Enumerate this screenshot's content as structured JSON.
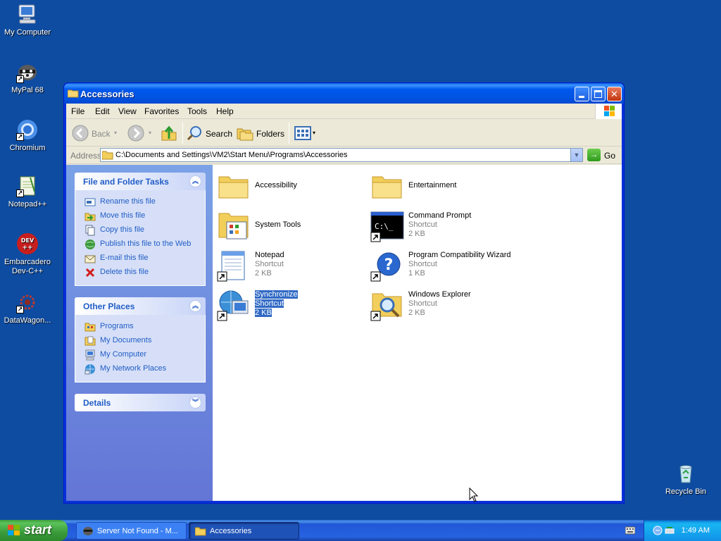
{
  "desktop": {
    "icons": [
      {
        "label": "My Computer",
        "icon": "my-computer-icon"
      },
      {
        "label": "MyPal 68",
        "icon": "mypal-icon"
      },
      {
        "label": "Chromium",
        "icon": "chromium-icon"
      },
      {
        "label": "Notepad++",
        "icon": "notepadpp-icon"
      },
      {
        "label": "Embarcadero Dev-C++",
        "label_line1": "Embarcadero",
        "label_line2": "Dev-C++",
        "icon": "devcpp-icon"
      },
      {
        "label": "DataWagon...",
        "icon": "datawagon-icon"
      },
      {
        "label": "Recycle Bin",
        "icon": "recycle-bin-icon"
      }
    ]
  },
  "window": {
    "title": "Accessories",
    "menu": [
      "File",
      "Edit",
      "View",
      "Favorites",
      "Tools",
      "Help"
    ],
    "toolbar": {
      "back_label": "Back",
      "search_label": "Search",
      "folders_label": "Folders"
    },
    "address": {
      "label": "Address",
      "value": "C:\\Documents and Settings\\VM2\\Start Menu\\Programs\\Accessories",
      "go_label": "Go"
    },
    "taskpane": {
      "file_tasks": {
        "title": "File and Folder Tasks",
        "items": [
          {
            "label": "Rename this file",
            "icon": "rename-icon"
          },
          {
            "label": "Move this file",
            "icon": "move-icon"
          },
          {
            "label": "Copy this file",
            "icon": "copy-icon"
          },
          {
            "label": "Publish this file to the Web",
            "icon": "publish-icon"
          },
          {
            "label": "E-mail this file",
            "icon": "email-icon"
          },
          {
            "label": "Delete this file",
            "icon": "delete-icon"
          }
        ]
      },
      "other_places": {
        "title": "Other Places",
        "items": [
          {
            "label": "Programs",
            "icon": "folder-icon"
          },
          {
            "label": "My Documents",
            "icon": "my-documents-icon"
          },
          {
            "label": "My Computer",
            "icon": "my-computer-icon"
          },
          {
            "label": "My Network Places",
            "icon": "network-places-icon"
          }
        ]
      },
      "details": {
        "title": "Details"
      }
    },
    "files": [
      {
        "name": "Accessibility",
        "type": "",
        "size": "",
        "icon": "folder-icon"
      },
      {
        "name": "Entertainment",
        "type": "",
        "size": "",
        "icon": "folder-icon"
      },
      {
        "name": "System Tools",
        "type": "",
        "size": "",
        "icon": "system-tools-folder-icon"
      },
      {
        "name": "Command Prompt",
        "type": "Shortcut",
        "size": "2 KB",
        "icon": "command-prompt-icon"
      },
      {
        "name": "Notepad",
        "type": "Shortcut",
        "size": "2 KB",
        "icon": "notepad-icon"
      },
      {
        "name": "Program Compatibility Wizard",
        "type": "Shortcut",
        "size": "1 KB",
        "icon": "help-icon"
      },
      {
        "name": "Synchronize",
        "type": "Shortcut",
        "size": "2 KB",
        "icon": "synchronize-icon",
        "selected": true
      },
      {
        "name": "Windows Explorer",
        "type": "Shortcut",
        "size": "2 KB",
        "icon": "windows-explorer-icon"
      }
    ]
  },
  "taskbar": {
    "start_label": "start",
    "tasks": [
      {
        "label": "Server Not Found - M...",
        "icon": "browser-icon",
        "active": false
      },
      {
        "label": "Accessories",
        "icon": "folder-icon",
        "active": true
      }
    ],
    "clock": "1:49 AM"
  },
  "colors": {
    "desktop_bg": "#0e4ca1",
    "titlebar": "#0054e3",
    "taskpane_link": "#215dc6",
    "selection": "#316ac5",
    "start_green": "#3a9a3a"
  }
}
